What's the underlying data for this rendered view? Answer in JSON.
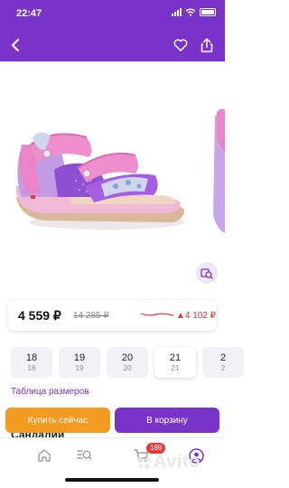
{
  "status": {
    "time": "22:47"
  },
  "price": {
    "current": "4 559 ₽",
    "old": "14 285 ₽",
    "diff": "▲4 102 ₽"
  },
  "sizes": [
    {
      "main": "18",
      "sub": "18"
    },
    {
      "main": "19",
      "sub": "19"
    },
    {
      "main": "20",
      "sub": "20"
    },
    {
      "main": "21",
      "sub": "21"
    },
    {
      "main": "2",
      "sub": "2"
    }
  ],
  "selected_size": "21",
  "size_table_link": "Таблица размеров",
  "buttons": {
    "buy": "Купить сейчас",
    "cart": "В корзину"
  },
  "product": {
    "title": "Сандалии"
  },
  "tabbar": {
    "cart_count": "189"
  },
  "watermark": "Avito",
  "colors": {
    "brand": "#7a33c8",
    "accent_orange": "#f39a21",
    "price_up_red": "#e0323a"
  }
}
